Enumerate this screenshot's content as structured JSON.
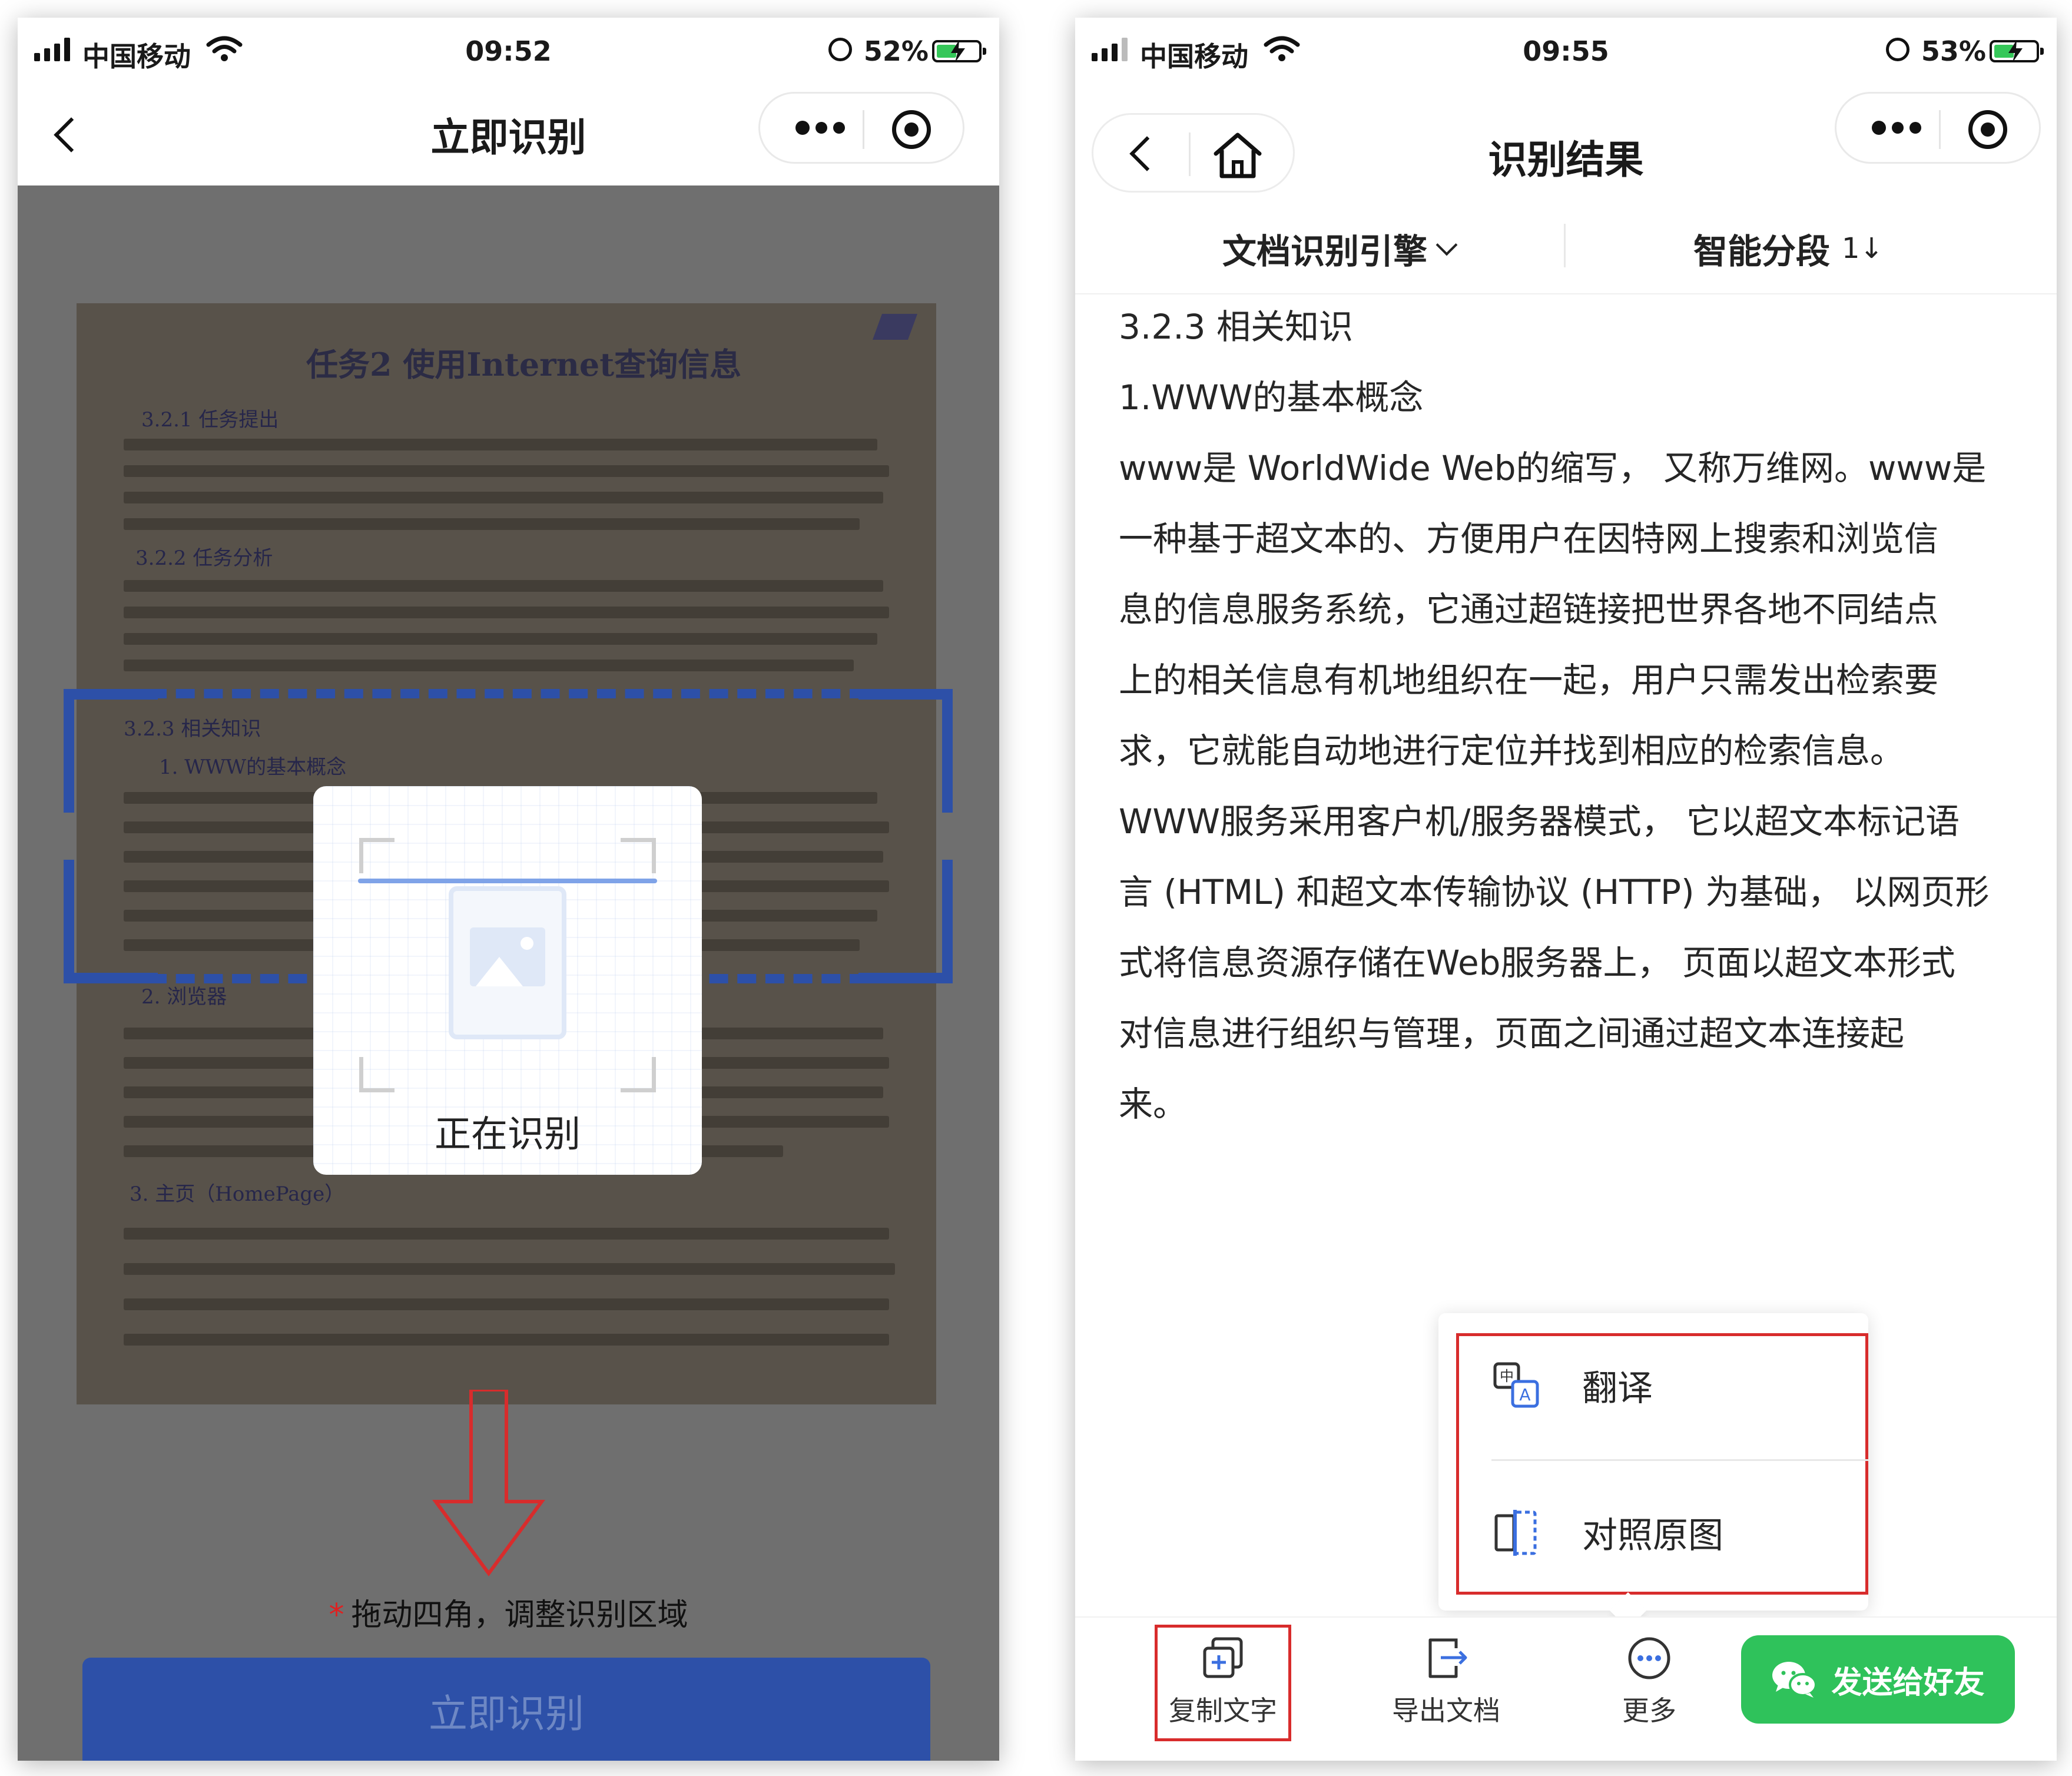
{
  "left": {
    "status": {
      "carrier": "中国移动",
      "time": "09:52",
      "battery": "52%",
      "battery_level": 0.52
    },
    "nav": {
      "title": "立即识别"
    },
    "document_photo": {
      "heading": "任务2  使用Internet查询信息",
      "sections": [
        "3.2.1  任务提出",
        "3.2.2  任务分析",
        "3.2.3  相关知识",
        "1. WWW的基本概念",
        "2. 浏览器",
        "3. 主页（HomePage）"
      ]
    },
    "dialog": {
      "label": "正在识别"
    },
    "hint": {
      "star": "*",
      "text": "拖动四角，调整识别区域"
    },
    "button": {
      "label": "立即识别"
    }
  },
  "right": {
    "status": {
      "carrier": "中国移动",
      "time": "09:55",
      "battery": "53%",
      "battery_level": 0.53
    },
    "nav": {
      "title": "识别结果"
    },
    "toolbar": {
      "engine": "文档识别引擎",
      "segment": "智能分段",
      "segment_icon": "1↓"
    },
    "result_text": [
      "3.2.3 相关知识",
      "1.WWW的基本概念",
      "www是 WorldWide Web的缩写， 又称万维网。www是",
      "一种基于超文本的、方便用户在因特网上搜索和浏览信",
      "息的信息服务系统，它通过超链接把世界各地不同结点",
      "上的相关信息有机地组织在一起，用户只需发出检索要",
      "求，它就能自动地进行定位并找到相应的检索信息。",
      "WWW服务采用客户机/服务器模式， 它以超文本标记语",
      "言 (HTML) 和超文本传输协议 (HTTP) 为基础， 以网页形",
      "式将信息资源存储在Web服务器上， 页面以超文本形式",
      "对信息进行组织与管理，页面之间通过超文本连接起",
      "来。"
    ],
    "popup": {
      "translate": "翻译",
      "compare": "对照原图"
    },
    "bottom": {
      "copy": "复制文字",
      "export": "导出文档",
      "more": "更多",
      "send": "发送给好友"
    }
  },
  "colors": {
    "primary_blue": "#2d50a8",
    "annotation_red": "#d82c2c",
    "wechat_green": "#2fc25b",
    "icon_blue": "#3b6fe0"
  }
}
